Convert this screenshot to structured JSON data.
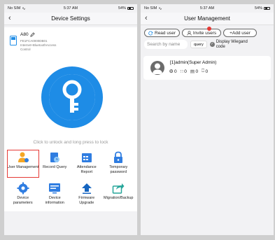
{
  "left_phone": {
    "status": {
      "carrier": "No SIM",
      "time": "5:37 AM",
      "battery": "54%"
    },
    "nav": {
      "title": "Device Settings"
    },
    "device": {
      "name": "A80",
      "serial": "FE1FCA0000DB01",
      "line2": "Internet+BluetoothAccess",
      "line3": "Control"
    },
    "unlock_hint": "Click to unlock and long press to lock",
    "menu": [
      {
        "label": "User Management",
        "icon": "user-management-icon",
        "color": "#f5a623"
      },
      {
        "label": "Record Query",
        "icon": "record-query-icon",
        "color": "#2f7de1"
      },
      {
        "label": "Attendance Report",
        "icon": "attendance-report-icon",
        "color": "#2f7de1"
      },
      {
        "label": "Temporary password",
        "icon": "temporary-password-icon",
        "color": "#2f7de1"
      },
      {
        "label": "Device parameters",
        "icon": "device-parameters-icon",
        "color": "#2f7de1"
      },
      {
        "label": "Device information",
        "icon": "device-information-icon",
        "color": "#2f7de1"
      },
      {
        "label": "Firmware Upgrade",
        "icon": "firmware-upgrade-icon",
        "color": "#1565c0"
      },
      {
        "label": "Migration/Backup",
        "icon": "migration-backup-icon",
        "color": "#26a69a"
      }
    ]
  },
  "right_phone": {
    "status": {
      "carrier": "No SIM",
      "time": "5:37 AM",
      "battery": "54%"
    },
    "nav": {
      "title": "User Management"
    },
    "buttons": {
      "read_user": "Read user",
      "invite_users": "Invite users",
      "add_user": "+Add user",
      "invite_badge": ""
    },
    "search": {
      "placeholder": "Search by name",
      "query": "query",
      "wiegand_label": "Display Wiegand code"
    },
    "users": [
      {
        "name": "[1]admin(Super Admin)",
        "fingerprint": "0",
        "password": "0",
        "card": "0",
        "face": "0"
      }
    ]
  },
  "colors": {
    "accent": "#1e8ce6",
    "highlight": "#e53935"
  }
}
